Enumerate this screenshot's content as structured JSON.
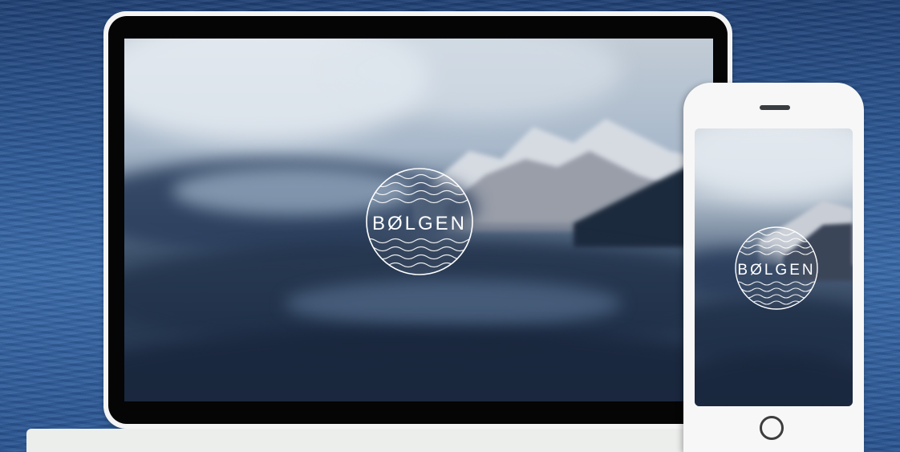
{
  "logo": {
    "text": "BØLGEN"
  },
  "colors": {
    "ocean": "#2e5a96",
    "device_frame": "#f3f4f3",
    "bezel": "#050505",
    "logo": "#ffffff"
  },
  "devices": [
    "laptop",
    "phone"
  ]
}
